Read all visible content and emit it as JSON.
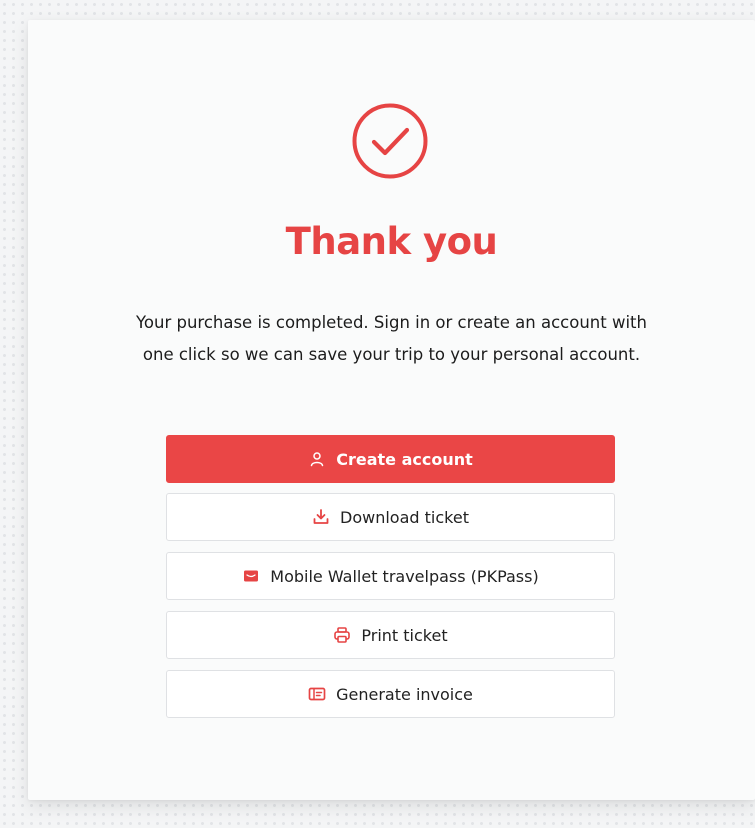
{
  "confirmation": {
    "title": "Thank you",
    "message": "Your purchase is completed. Sign in or create an account with one click so we can save your trip to your personal account."
  },
  "actions": [
    {
      "label": "Create account",
      "icon": "user-icon"
    },
    {
      "label": "Download ticket",
      "icon": "download-icon"
    },
    {
      "label": "Mobile Wallet travelpass (PKPass)",
      "icon": "wallet-icon"
    },
    {
      "label": "Print ticket",
      "icon": "printer-icon"
    },
    {
      "label": "Generate invoice",
      "icon": "invoice-icon"
    }
  ],
  "colors": {
    "accent": "#ea4646",
    "title": "#e64444",
    "text": "#1c1c1c",
    "border": "#dfe1e4",
    "card": "#fafbfb"
  }
}
